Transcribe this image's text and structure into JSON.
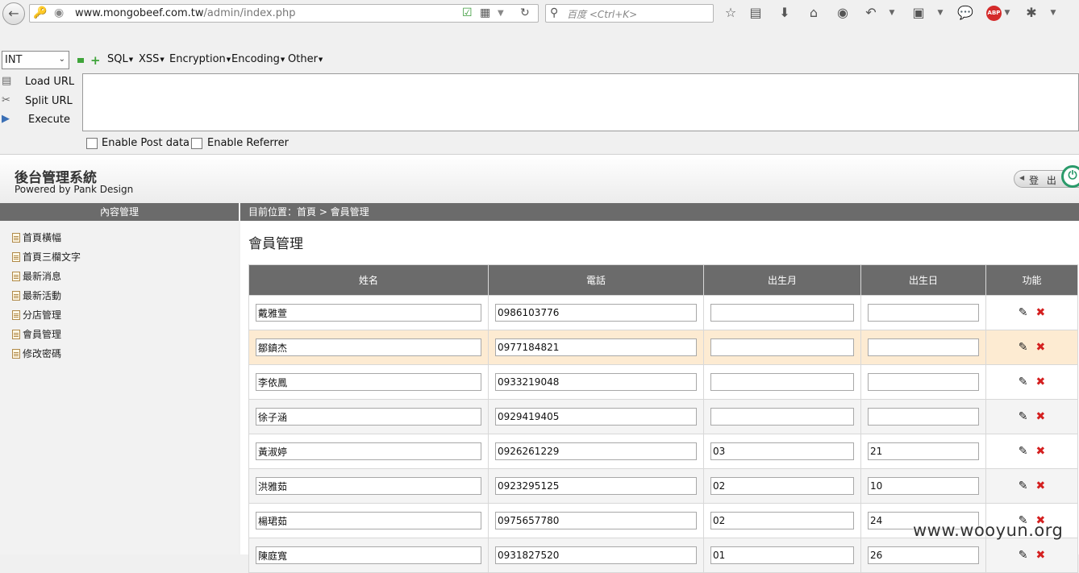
{
  "browser": {
    "url_host": "www.mongobeef.com.tw",
    "url_path": "/admin/index.php",
    "search_placeholder": "百度 <Ctrl+K>",
    "abp_label": "ABP"
  },
  "hackbar": {
    "type_value": "INT",
    "menus": [
      "SQL",
      "XSS",
      "Encryption",
      "Encoding",
      "Other"
    ],
    "load_url": "Load URL",
    "split_url": "Split URL",
    "execute": "Execute",
    "enable_post": "Enable Post data",
    "enable_referrer": "Enable Referrer"
  },
  "admin": {
    "title": "後台管理系統",
    "subtitle": "Powered by Pank Design",
    "logout_label": "登 出"
  },
  "sidebar": {
    "header": "內容管理",
    "items": [
      {
        "label": "首頁橫幅"
      },
      {
        "label": "首頁三欄文字"
      },
      {
        "label": "最新消息"
      },
      {
        "label": "最新活動"
      },
      {
        "label": "分店管理"
      },
      {
        "label": "會員管理"
      },
      {
        "label": "修改密碼"
      }
    ]
  },
  "breadcrumb": "目前位置：首頁 > 會員管理",
  "page_title": "會員管理",
  "table": {
    "headers": [
      "姓名",
      "電話",
      "出生月",
      "出生日",
      "功能"
    ],
    "rows": [
      {
        "name": "戴雅萱",
        "phone": "0986103776",
        "month": "",
        "day": ""
      },
      {
        "name": "鄒鎮杰",
        "phone": "0977184821",
        "month": "",
        "day": ""
      },
      {
        "name": "李依鳳",
        "phone": "0933219048",
        "month": "",
        "day": ""
      },
      {
        "name": "徐子涵",
        "phone": "0929419405",
        "month": "",
        "day": ""
      },
      {
        "name": "黃淑婷",
        "phone": "0926261229",
        "month": "03",
        "day": "21"
      },
      {
        "name": "洪雅茹",
        "phone": "0923295125",
        "month": "02",
        "day": "10"
      },
      {
        "name": "楊珺茹",
        "phone": "0975657780",
        "month": "02",
        "day": "24"
      },
      {
        "name": "陳庭寬",
        "phone": "0931827520",
        "month": "01",
        "day": "26"
      }
    ]
  },
  "watermark": "www.wooyun.org"
}
